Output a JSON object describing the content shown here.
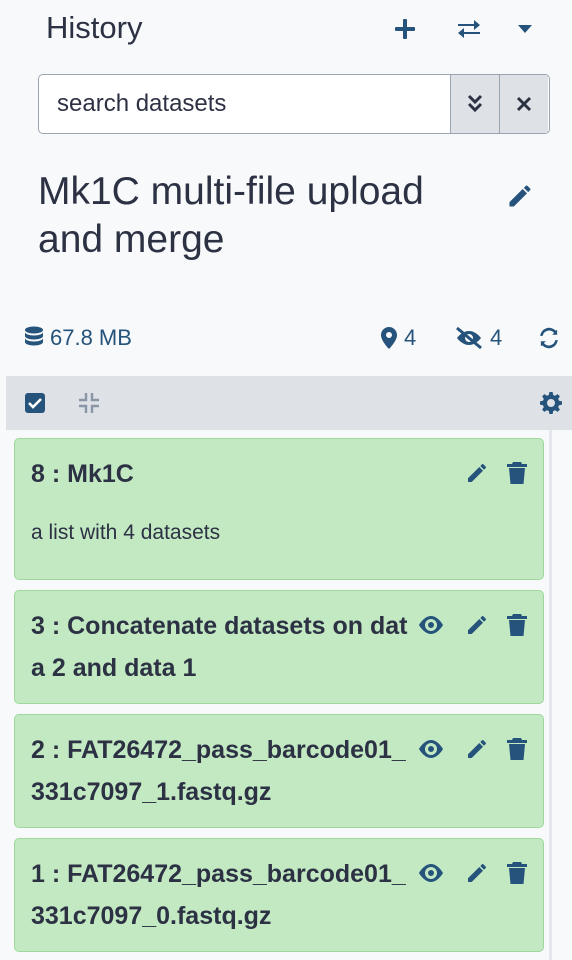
{
  "header": {
    "title": "History",
    "icons": [
      "plus-icon",
      "switch-icon",
      "caret-down-icon"
    ]
  },
  "search": {
    "placeholder": "search datasets",
    "value": ""
  },
  "history": {
    "name": "Mk1C multi-file upload and merge"
  },
  "stats": {
    "size": "67.8 MB",
    "shown_count": "4",
    "hidden_count": "4"
  },
  "colors": {
    "accent": "#25537b",
    "item_ok_bg": "#c3e9c3",
    "toolbar_bg": "#dee2e6",
    "text": "#2c3143"
  },
  "items": [
    {
      "title": "8 : Mk1C",
      "subtitle": "a list with 4 datasets",
      "state": "ok"
    },
    {
      "title": "3 : Concatenate datasets on data 2 and data 1",
      "state": "ok"
    },
    {
      "title": "2 : FAT26472_pass_barcode01_331c7097_1.fastq.gz",
      "state": "ok"
    },
    {
      "title": "1 : FAT26472_pass_barcode01_331c7097_0.fastq.gz",
      "state": "ok"
    }
  ]
}
